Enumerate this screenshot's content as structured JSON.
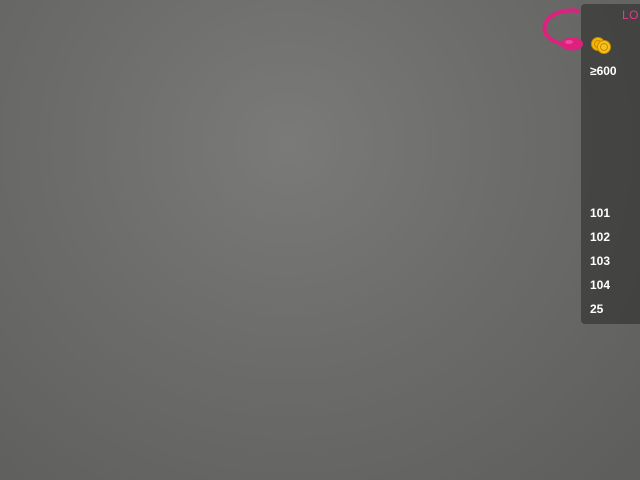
{
  "overlay": {
    "brand_label": "LO",
    "toy_icon": "pink-vibrator-icon",
    "coin_icon": "gold-coins-icon",
    "colors": {
      "brand": "#e23b8c",
      "coin": "#f5b800",
      "text": "#ffffff"
    },
    "levels": [
      {
        "label": "≥600"
      },
      {
        "label": "101"
      },
      {
        "label": "102"
      },
      {
        "label": "103"
      },
      {
        "label": "104"
      },
      {
        "label": "25"
      }
    ]
  }
}
